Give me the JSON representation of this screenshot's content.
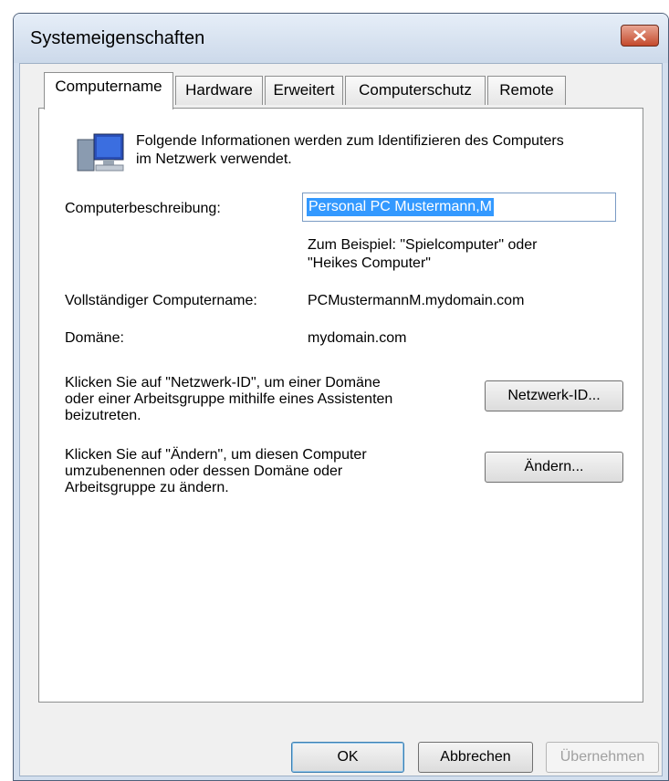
{
  "window": {
    "title": "Systemeigenschaften"
  },
  "tabs": [
    {
      "label": "Computername",
      "active": true
    },
    {
      "label": "Hardware"
    },
    {
      "label": "Erweitert"
    },
    {
      "label": "Computerschutz"
    },
    {
      "label": "Remote"
    }
  ],
  "intro": {
    "line1": "Folgende Informationen werden zum Identifizieren des Computers",
    "line2": "im Netzwerk verwendet."
  },
  "description": {
    "label": "Computerbeschreibung:",
    "value": "Personal PC Mustermann,M",
    "hint_line1": "Zum Beispiel: \"Spielcomputer\" oder",
    "hint_line2": "\"Heikes Computer\""
  },
  "fullname": {
    "label": "Vollständiger Computername:",
    "value": "PCMustermannM.mydomain.com"
  },
  "domain": {
    "label": "Domäne:",
    "value": "mydomain.com"
  },
  "network_id": {
    "line1": "Klicken Sie auf \"Netzwerk-ID\", um einer Domäne",
    "line2": "oder einer Arbeitsgruppe mithilfe eines Assistenten",
    "line3": "beizutreten.",
    "button": "Netzwerk-ID..."
  },
  "change": {
    "line1": "Klicken Sie auf \"Ändern\", um diesen Computer",
    "line2": "umzubenennen oder dessen Domäne oder",
    "line3": "Arbeitsgruppe zu ändern.",
    "button": "Ändern..."
  },
  "footer": {
    "ok": "OK",
    "cancel": "Abbrechen",
    "apply": "Übernehmen"
  }
}
